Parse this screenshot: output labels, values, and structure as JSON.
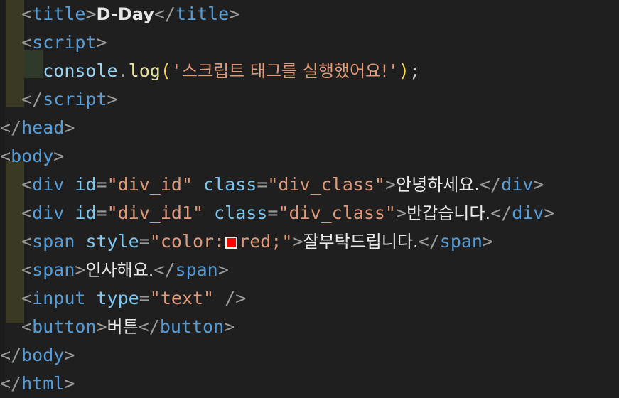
{
  "editor": {
    "background_color": "#1f1f1f",
    "indent_guide_color": "#3a3a24",
    "indent_guide_deep_color": "#2f3a2b",
    "language": "html",
    "color_swatch": {
      "name": "red-color-swatch",
      "color": "#ff0000",
      "border_color": "#e8e8e8"
    },
    "palette": {
      "punctuation": "#9b9b9b",
      "tag": "#569cd6",
      "attribute": "#7cc7f0",
      "string": "#e09a7a",
      "text": "#e8e8e8",
      "object": "#9ad4f5",
      "function": "#e8e4a0",
      "paren": "#f2d64b"
    }
  },
  "code": {
    "lines": [
      {
        "n": 1,
        "indent": "  ",
        "tokens": [
          {
            "t": "pn",
            "v": "<"
          },
          {
            "t": "tag",
            "v": "title"
          },
          {
            "t": "pn",
            "v": ">"
          },
          {
            "t": "ttl",
            "v": "D-Day"
          },
          {
            "t": "pn",
            "v": "</"
          },
          {
            "t": "tag",
            "v": "title"
          },
          {
            "t": "pn",
            "v": ">"
          }
        ]
      },
      {
        "n": 2,
        "indent": "  ",
        "tokens": [
          {
            "t": "pn",
            "v": "<"
          },
          {
            "t": "tag",
            "v": "script"
          },
          {
            "t": "pn",
            "v": ">"
          }
        ]
      },
      {
        "n": 3,
        "indent": "    ",
        "tokens": [
          {
            "t": "obj",
            "v": "console"
          },
          {
            "t": "pn",
            "v": "."
          },
          {
            "t": "fn",
            "v": "log"
          },
          {
            "t": "par",
            "v": "("
          },
          {
            "t": "str",
            "v": "'"
          },
          {
            "t": "str kor",
            "v": "스크립트 태그를 실행했어요!"
          },
          {
            "t": "str",
            "v": "'"
          },
          {
            "t": "par",
            "v": ")"
          },
          {
            "t": "sem",
            "v": ";"
          }
        ]
      },
      {
        "n": 4,
        "indent": "  ",
        "tokens": [
          {
            "t": "pn",
            "v": "</"
          },
          {
            "t": "tag",
            "v": "script"
          },
          {
            "t": "pn",
            "v": ">"
          }
        ]
      },
      {
        "n": 5,
        "indent": "",
        "tokens": [
          {
            "t": "pn",
            "v": "</"
          },
          {
            "t": "tag",
            "v": "head"
          },
          {
            "t": "pn",
            "v": ">"
          }
        ]
      },
      {
        "n": 6,
        "indent": "",
        "tokens": [
          {
            "t": "pn",
            "v": "<"
          },
          {
            "t": "tag",
            "v": "body"
          },
          {
            "t": "pn",
            "v": ">"
          }
        ]
      },
      {
        "n": 7,
        "indent": "  ",
        "tokens": [
          {
            "t": "pn",
            "v": "<"
          },
          {
            "t": "tag",
            "v": "div"
          },
          {
            "t": "pn",
            "v": " "
          },
          {
            "t": "att",
            "v": "id"
          },
          {
            "t": "pn",
            "v": "="
          },
          {
            "t": "str",
            "v": "\"div_id\""
          },
          {
            "t": "pn",
            "v": " "
          },
          {
            "t": "att",
            "v": "class"
          },
          {
            "t": "pn",
            "v": "="
          },
          {
            "t": "str",
            "v": "\"div_class\""
          },
          {
            "t": "pn",
            "v": ">"
          },
          {
            "t": "txt kor",
            "v": "안녕하세요."
          },
          {
            "t": "pn",
            "v": "</"
          },
          {
            "t": "tag",
            "v": "div"
          },
          {
            "t": "pn",
            "v": ">"
          }
        ]
      },
      {
        "n": 8,
        "indent": "  ",
        "tokens": [
          {
            "t": "pn",
            "v": "<"
          },
          {
            "t": "tag",
            "v": "div"
          },
          {
            "t": "pn",
            "v": " "
          },
          {
            "t": "att",
            "v": "id"
          },
          {
            "t": "pn",
            "v": "="
          },
          {
            "t": "str",
            "v": "\"div_id1\""
          },
          {
            "t": "pn",
            "v": " "
          },
          {
            "t": "att",
            "v": "class"
          },
          {
            "t": "pn",
            "v": "="
          },
          {
            "t": "str",
            "v": "\"div_class\""
          },
          {
            "t": "pn",
            "v": ">"
          },
          {
            "t": "txt kor",
            "v": "반갑습니다."
          },
          {
            "t": "pn",
            "v": "</"
          },
          {
            "t": "tag",
            "v": "div"
          },
          {
            "t": "pn",
            "v": ">"
          }
        ]
      },
      {
        "n": 9,
        "indent": "  ",
        "tokens": [
          {
            "t": "pn",
            "v": "<"
          },
          {
            "t": "tag",
            "v": "span"
          },
          {
            "t": "pn",
            "v": " "
          },
          {
            "t": "att",
            "v": "style"
          },
          {
            "t": "pn",
            "v": "="
          },
          {
            "t": "str",
            "v": "\"color:"
          },
          {
            "t": "swatch",
            "v": ""
          },
          {
            "t": "str",
            "v": "red;\""
          },
          {
            "t": "pn",
            "v": ">"
          },
          {
            "t": "txt kor",
            "v": "잘부탁드립니다."
          },
          {
            "t": "pn",
            "v": "</"
          },
          {
            "t": "tag",
            "v": "span"
          },
          {
            "t": "pn",
            "v": ">"
          }
        ]
      },
      {
        "n": 10,
        "indent": "  ",
        "tokens": [
          {
            "t": "pn",
            "v": "<"
          },
          {
            "t": "tag",
            "v": "span"
          },
          {
            "t": "pn",
            "v": ">"
          },
          {
            "t": "txt kor",
            "v": "인사해요."
          },
          {
            "t": "pn",
            "v": "</"
          },
          {
            "t": "tag",
            "v": "span"
          },
          {
            "t": "pn",
            "v": ">"
          }
        ]
      },
      {
        "n": 11,
        "indent": "  ",
        "tokens": [
          {
            "t": "pn",
            "v": "<"
          },
          {
            "t": "tag",
            "v": "input"
          },
          {
            "t": "pn",
            "v": " "
          },
          {
            "t": "att",
            "v": "type"
          },
          {
            "t": "pn",
            "v": "="
          },
          {
            "t": "str",
            "v": "\"text\""
          },
          {
            "t": "pn",
            "v": " />"
          }
        ]
      },
      {
        "n": 12,
        "indent": "  ",
        "tokens": [
          {
            "t": "pn",
            "v": "<"
          },
          {
            "t": "tag",
            "v": "button"
          },
          {
            "t": "pn",
            "v": ">"
          },
          {
            "t": "txt kor",
            "v": "버튼"
          },
          {
            "t": "pn",
            "v": "</"
          },
          {
            "t": "tag",
            "v": "button"
          },
          {
            "t": "pn",
            "v": ">"
          }
        ]
      },
      {
        "n": 13,
        "indent": "",
        "tokens": [
          {
            "t": "pn",
            "v": "</"
          },
          {
            "t": "tag",
            "v": "body"
          },
          {
            "t": "pn",
            "v": ">"
          }
        ]
      },
      {
        "n": 14,
        "indent": "",
        "tokens": [
          {
            "t": "pn",
            "v": "</"
          },
          {
            "t": "tag",
            "v": "html"
          },
          {
            "t": "pn",
            "v": ">"
          }
        ]
      }
    ]
  }
}
